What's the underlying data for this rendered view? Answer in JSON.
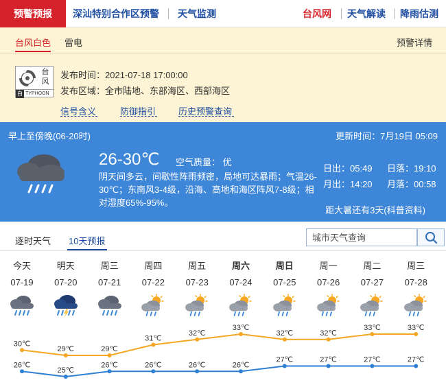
{
  "nav": {
    "tabs": [
      {
        "label": "预警预报"
      },
      {
        "label": "深汕特别合作区预警"
      },
      {
        "label": "天气监测"
      },
      {
        "label": "台风网"
      },
      {
        "label": "天气解读"
      },
      {
        "label": "降雨估测"
      }
    ]
  },
  "warning": {
    "tabs": [
      {
        "label": "台风白色"
      },
      {
        "label": "雷电"
      }
    ],
    "detail_link": "预警详情",
    "badge": {
      "chars_top": "台",
      "chars_bottom": "风",
      "color_word": "白",
      "english": "TYPHOON"
    },
    "issue_label": "发布时间：",
    "issue_time": "2021-07-18 17:00:00",
    "area_label": "发布区域：",
    "area": "全市陆地、东部海区、西部海区",
    "links": [
      "信号含义",
      "防御指引",
      "历史预警查询"
    ]
  },
  "forecast": {
    "period": "早上至傍晚(06-20时)",
    "updated": "更新时间：7月19日 05:09",
    "temperature": "26-30℃",
    "air_quality": "空气质量：  优",
    "description": "阴天间多云，间歇性阵雨频密，局地可达暴雨；气温26-30℃；东南风3-4级，沿海、高地和海区阵风7-8级；相对湿度65%-95%。",
    "sunrise": "日出：05:49",
    "sunset": "日落：19:10",
    "moonrise": "月出：14:20",
    "moonset": "月落：00:58",
    "solar_term_note": "距大暑还有3天(科普资料)"
  },
  "forecast_tabs": [
    {
      "label": "逐时天气"
    },
    {
      "label": "10天预报"
    }
  ],
  "search": {
    "placeholder": "城市天气查询"
  },
  "days": [
    {
      "weekday": "今天",
      "date": "07-19",
      "icon": "rain-cloud-icon",
      "bold": false
    },
    {
      "weekday": "明天",
      "date": "07-20",
      "icon": "storm-cloud-icon",
      "bold": false
    },
    {
      "weekday": "周三",
      "date": "07-21",
      "icon": "rain-cloud-icon",
      "bold": false
    },
    {
      "weekday": "周四",
      "date": "07-22",
      "icon": "sun-rain-icon",
      "bold": false
    },
    {
      "weekday": "周五",
      "date": "07-23",
      "icon": "sun-rain-icon",
      "bold": false
    },
    {
      "weekday": "周六",
      "date": "07-24",
      "icon": "sun-rain-icon",
      "bold": true
    },
    {
      "weekday": "周日",
      "date": "07-25",
      "icon": "sun-rain-icon",
      "bold": true
    },
    {
      "weekday": "周一",
      "date": "07-26",
      "icon": "sun-rain-icon",
      "bold": false
    },
    {
      "weekday": "周二",
      "date": "07-27",
      "icon": "sun-rain-icon",
      "bold": false
    },
    {
      "weekday": "周三",
      "date": "07-28",
      "icon": "sun-rain-icon",
      "bold": false
    }
  ],
  "colors": {
    "brand_red": "#d6232b",
    "nav_blue": "#1f4ea1",
    "panel_blue": "#3d86d8",
    "high_line": "#f5a623",
    "low_line": "#2f7fd3"
  },
  "chart_data": {
    "type": "line",
    "x": [
      "07-19",
      "07-20",
      "07-21",
      "07-22",
      "07-23",
      "07-24",
      "07-25",
      "07-26",
      "07-27",
      "07-28"
    ],
    "series": [
      {
        "values": [
          30,
          29,
          29,
          31,
          32,
          33,
          32,
          32,
          33,
          33
        ],
        "labels": [
          "30℃",
          "29℃",
          "29℃",
          "31℃",
          "32℃",
          "33℃",
          "32℃",
          "32℃",
          "33℃",
          "33℃"
        ]
      },
      {
        "values": [
          26,
          25,
          26,
          26,
          26,
          26,
          27,
          27,
          27,
          27
        ],
        "labels": [
          "26℃",
          "25℃",
          "26℃",
          "26℃",
          "26℃",
          "26℃",
          "27℃",
          "27℃",
          "27℃",
          "27℃"
        ]
      }
    ]
  }
}
